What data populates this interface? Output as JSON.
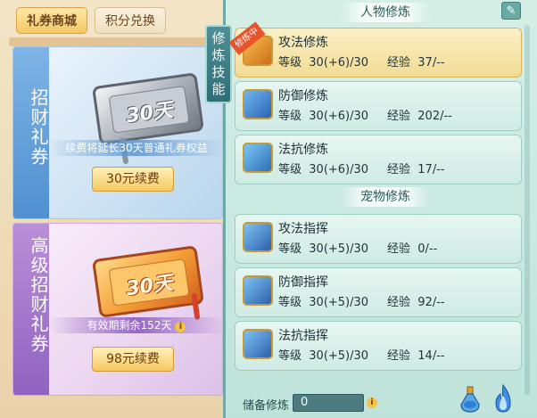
{
  "tabs": {
    "shop": "礼券商城",
    "points": "积分兑换"
  },
  "cards": [
    {
      "ribbon": "招财礼券",
      "ticket_text": "30天",
      "note": "续费将延长30天普通礼券权益",
      "button": "30元续费"
    },
    {
      "ribbon": "高级招财礼券",
      "ticket_text": "30天",
      "note": "有效期剩余152天",
      "button": "98元续费"
    }
  ],
  "right": {
    "vertical_tab": [
      "修",
      "炼",
      "技",
      "能"
    ],
    "sections": [
      {
        "title": "人物修炼",
        "rows": [
          {
            "title": "攻法修炼",
            "level_label": "等级",
            "level": "30(+6)/30",
            "exp_label": "经验",
            "exp": "37/--",
            "badge": "修炼中",
            "icon": "sword-icon"
          },
          {
            "title": "防御修炼",
            "level_label": "等级",
            "level": "30(+6)/30",
            "exp_label": "经验",
            "exp": "202/--",
            "badge": "",
            "icon": "shield-icon"
          },
          {
            "title": "法抗修炼",
            "level_label": "等级",
            "level": "30(+6)/30",
            "exp_label": "经验",
            "exp": "17/--",
            "badge": "",
            "icon": "yinyang-icon"
          }
        ]
      },
      {
        "title": "宠物修炼",
        "rows": [
          {
            "title": "攻法指挥",
            "level_label": "等级",
            "level": "30(+5)/30",
            "exp_label": "经验",
            "exp": "0/--",
            "badge": "",
            "icon": "paw-attack-icon"
          },
          {
            "title": "防御指挥",
            "level_label": "等级",
            "level": "30(+5)/30",
            "exp_label": "经验",
            "exp": "92/--",
            "badge": "",
            "icon": "paw-shield-icon"
          },
          {
            "title": "法抗指挥",
            "level_label": "等级",
            "level": "30(+5)/30",
            "exp_label": "经验",
            "exp": "14/--",
            "badge": "",
            "icon": "paw-magic-icon"
          }
        ]
      }
    ],
    "reserve": {
      "label": "储备修炼",
      "value": "0"
    }
  }
}
